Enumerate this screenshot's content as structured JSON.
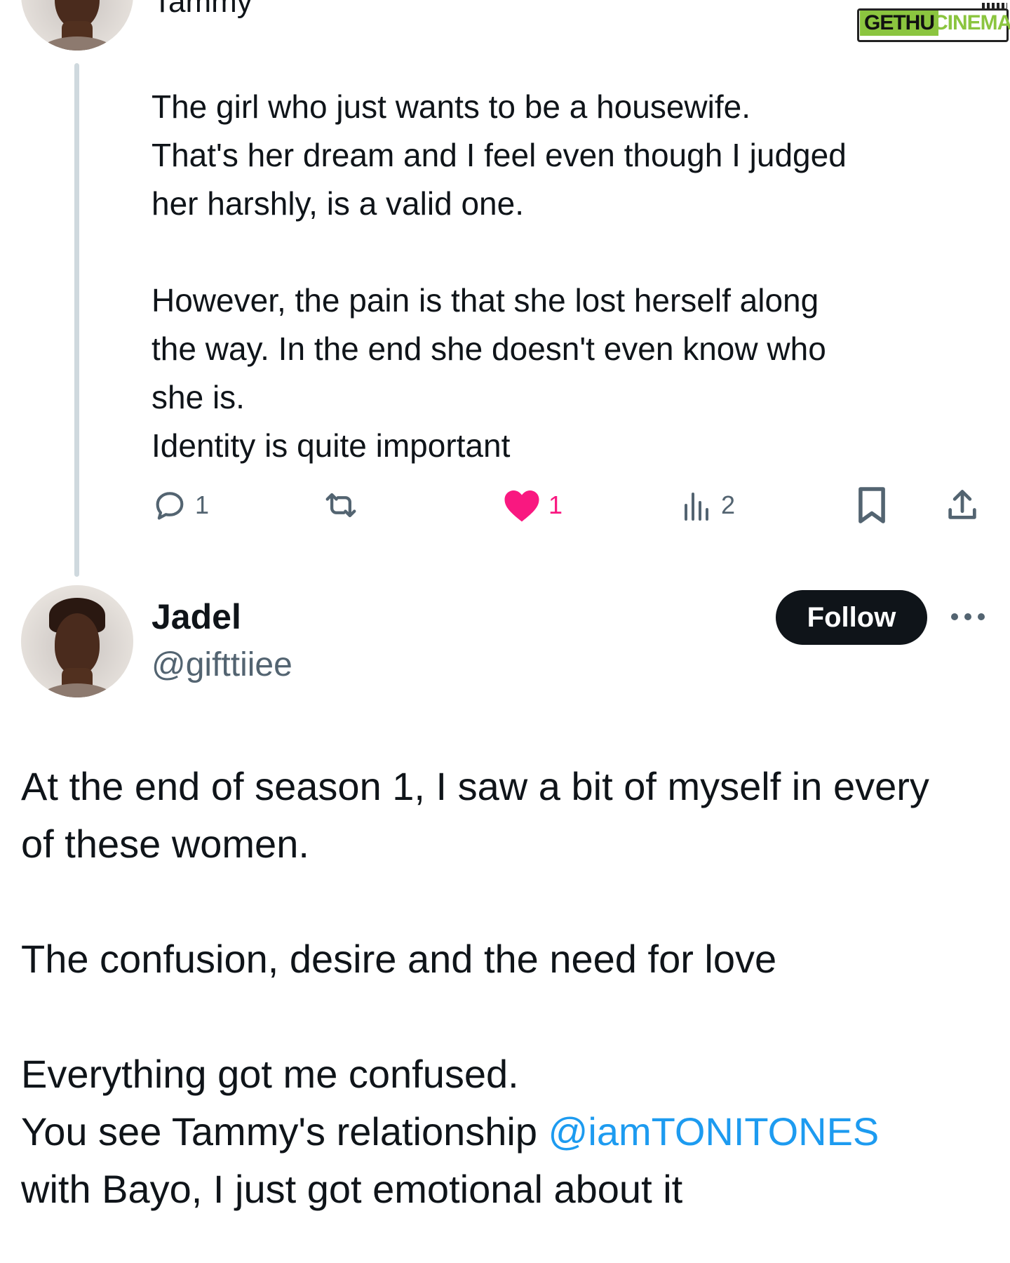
{
  "watermark": {
    "part1": "GETHU",
    "part2": "CINEMA"
  },
  "parent_tweet": {
    "author_name": "Tammy",
    "paragraph1": [
      "The girl who just wants to be a housewife.",
      "That's her dream and I feel even though I judged",
      "her harshly, is a valid one."
    ],
    "paragraph2": [
      "However, the pain is that she lost herself along",
      "the way. In the end she doesn't even know who",
      "she is.",
      "Identity is quite important"
    ],
    "replies": "1",
    "likes": "1",
    "views": "2",
    "icons": [
      "reply-icon",
      "retweet-icon",
      "heart-icon",
      "views-icon",
      "bookmark-icon",
      "share-icon"
    ],
    "colors": {
      "like": "#f91880",
      "icon": "#536471"
    }
  },
  "reply_tweet": {
    "author_name": "Jadel",
    "handle": "@gifttiiee",
    "follow_label": "Follow",
    "paragraph1": [
      "At the end of season 1, I saw a bit of myself in every",
      "of these women."
    ],
    "paragraph2": "The confusion, desire and the need for love",
    "paragraph3_line1": "Everything got me confused.",
    "paragraph3_line2_before": "You see Tammy's relationship ",
    "mention": "@iamTONITONES",
    "paragraph3_line3": "with Bayo, I just got emotional about it",
    "colors": {
      "mention": "#1d9bf0",
      "follow_bg": "#0f1419"
    }
  }
}
